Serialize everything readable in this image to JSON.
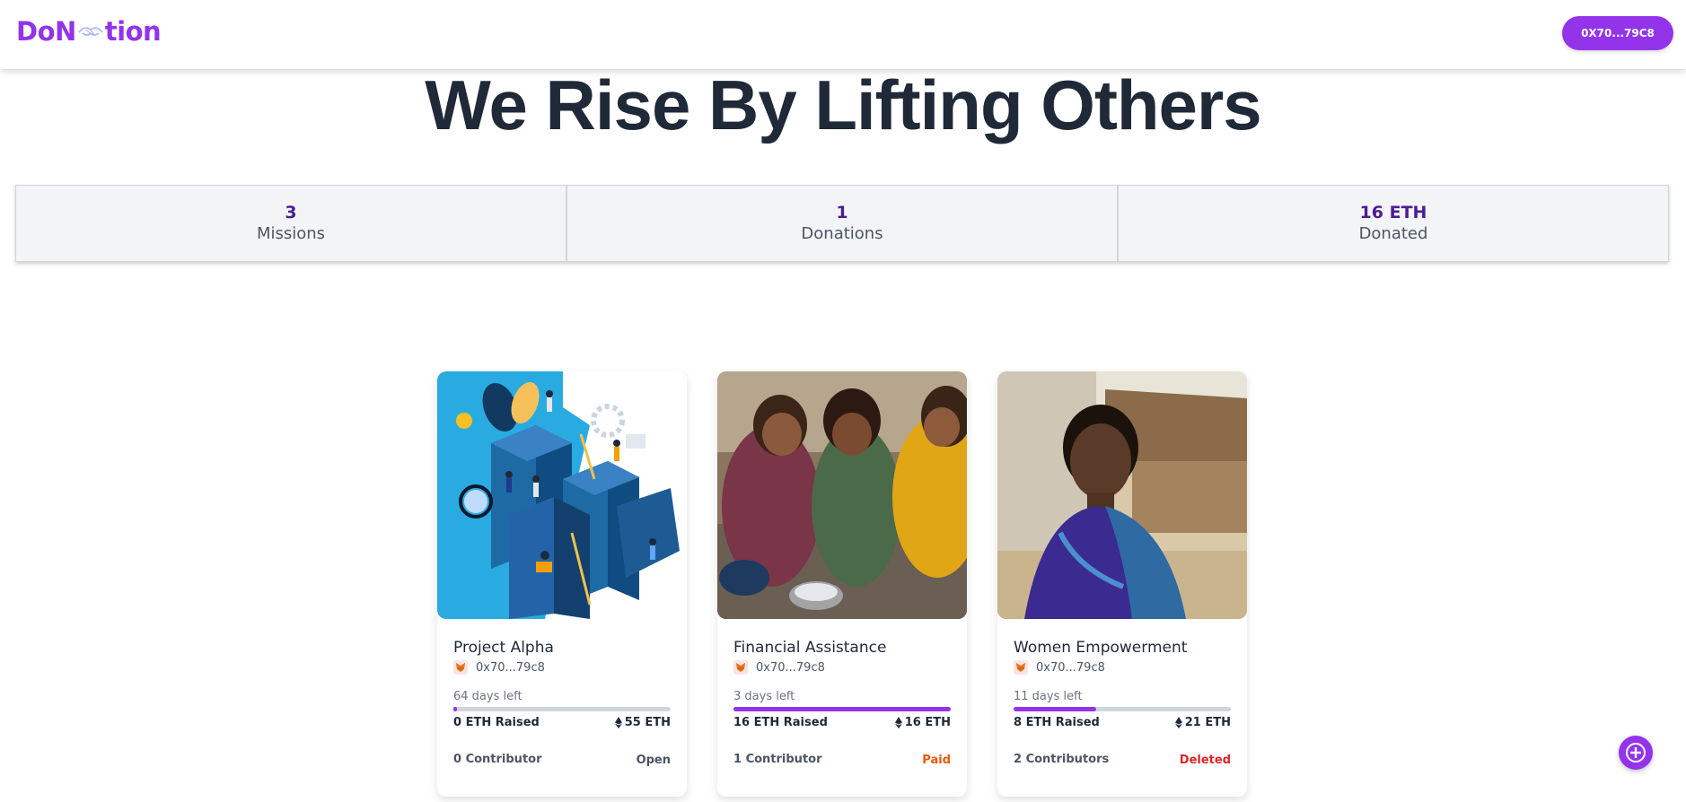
{
  "header": {
    "logo_text_left": "DoN",
    "logo_text_right": "tion",
    "wallet_label": "0X70...79C8"
  },
  "hero": {
    "title": "We Rise By Lifting Others"
  },
  "stats": [
    {
      "value": "3",
      "label": "Missions"
    },
    {
      "value": "1",
      "label": "Donations"
    },
    {
      "value": "16 ETH",
      "label": "Donated"
    }
  ],
  "projects": [
    {
      "title": "Project Alpha",
      "owner": "0x70...79c8",
      "days_left": "64 days left",
      "raised": "0 ETH Raised",
      "target": "55 ETH",
      "progress_fraction": 0.0,
      "contributors": "0 Contributor",
      "status": "Open",
      "status_color": "#4b5563",
      "image_icon": "team-business-illustration"
    },
    {
      "title": "Financial Assistance",
      "owner": "0x70...79c8",
      "days_left": "3 days left",
      "raised": "16 ETH Raised",
      "target": "16 ETH",
      "progress_fraction": 1.0,
      "contributors": "1 Contributor",
      "status": "Paid",
      "status_color": "#ea580c",
      "image_icon": "children-eating-photo"
    },
    {
      "title": "Women Empowerment",
      "owner": "0x70...79c8",
      "days_left": "11 days left",
      "raised": "8 ETH Raised",
      "target": "21 ETH",
      "progress_fraction": 0.38,
      "contributors": "2 Contributors",
      "status": "Deleted",
      "status_color": "#dc2626",
      "image_icon": "woman-village-photo"
    }
  ],
  "colors": {
    "accent": "#9333ea",
    "dark_text": "#1f2937",
    "stat_value": "#4c1d95"
  },
  "fab": {
    "icon": "plus-icon"
  }
}
